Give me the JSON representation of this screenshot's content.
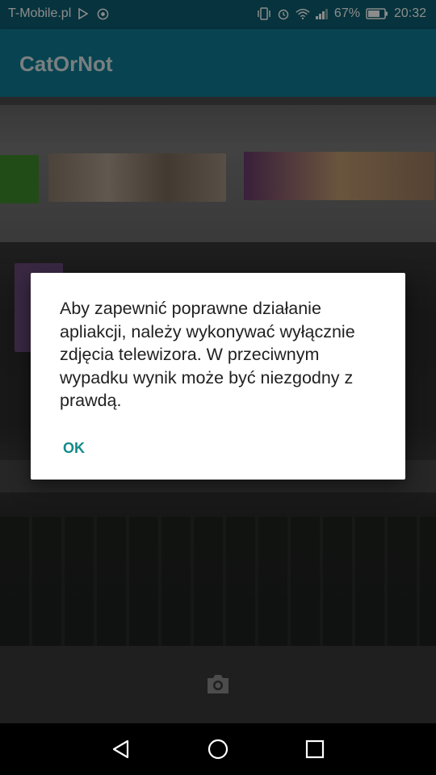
{
  "status_bar": {
    "carrier": "T-Mobile.pl",
    "battery_percent": "67%",
    "time": "20:32",
    "icons": [
      "play-store-icon",
      "chrome-icon",
      "vibrate-icon",
      "alarm-icon",
      "wifi-icon",
      "signal-icon",
      "battery-icon"
    ]
  },
  "app_bar": {
    "title": "CatOrNot"
  },
  "dialog": {
    "message": "Aby zapewnić poprawne działanie apliakcji, należy wykonywać wyłącznie zdjęcia telewizora. W przeciwnym wypadku wynik może być niezgodny z prawdą.",
    "ok_label": "OK",
    "accent_color": "#128a8a"
  },
  "controls": {
    "camera_icon": "camera-icon"
  },
  "nav_bar": {
    "icons": [
      "back-icon",
      "home-icon",
      "recents-icon"
    ]
  },
  "colors": {
    "app_bar": "#0e7a92",
    "status_bar": "#0b5d70"
  }
}
